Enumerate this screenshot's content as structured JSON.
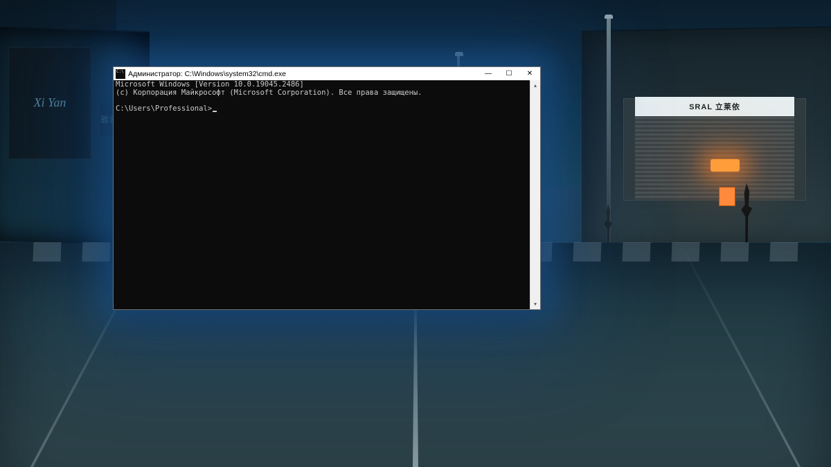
{
  "wallpaper": {
    "banner_left": "Xi Yan",
    "cn_sign": "雅名",
    "storefront_sign": "SRAL 立莱依"
  },
  "window": {
    "title": "Администратор: C:\\Windows\\system32\\cmd.exe",
    "controls": {
      "minimize": "—",
      "maximize": "☐",
      "close": "✕"
    },
    "scrollbar": {
      "up": "▴",
      "down": "▾"
    }
  },
  "terminal": {
    "line1": "Microsoft Windows [Version 10.0.19045.2486]",
    "line2": "(c) Корпорация Майкрософт (Microsoft Corporation). Все права защищены.",
    "blank": "",
    "prompt": "C:\\Users\\Professional>"
  }
}
